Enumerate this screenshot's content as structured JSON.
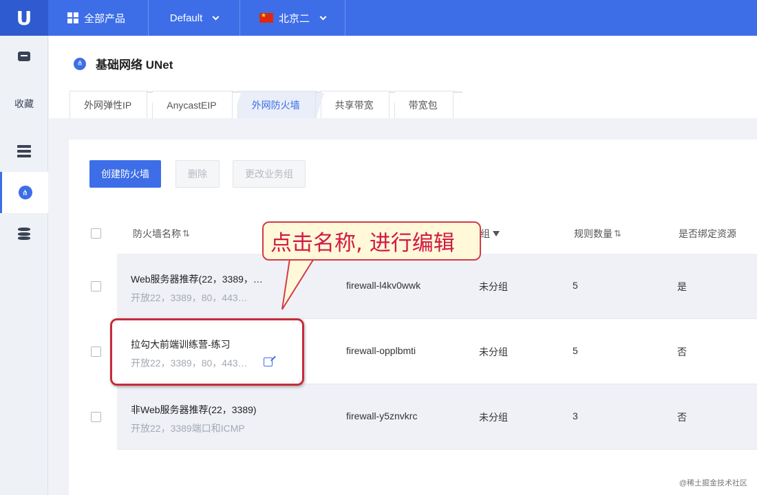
{
  "topbar": {
    "logo": "U",
    "all_products": "全部产品",
    "project": "Default",
    "region": "北京二"
  },
  "sidebar": {
    "favorites_label": "收藏"
  },
  "header": {
    "title": "基础网络 UNet",
    "tabs": [
      {
        "label": "外网弹性IP"
      },
      {
        "label": "AnycastEIP"
      },
      {
        "label": "外网防火墙"
      },
      {
        "label": "共享带宽"
      },
      {
        "label": "带宽包"
      }
    ],
    "active_tab": "外网防火墙"
  },
  "toolbar": {
    "create_label": "创建防火墙",
    "delete_label": "删除",
    "change_group_label": "更改业务组"
  },
  "table": {
    "columns": {
      "name": "防火墙名称",
      "group": "业务组",
      "rules": "规则数量",
      "bound": "是否绑定资源"
    },
    "rows": [
      {
        "name": "Web服务器推荐(22，3389，…",
        "desc": "开放22，3389，80，443…",
        "id": "firewall-l4kv0wwk",
        "group": "未分组",
        "rules": "5",
        "bound": "是"
      },
      {
        "name": "拉勾大前端训练营-练习",
        "desc": "开放22，3389，80，443…",
        "id": "firewall-opplbmti",
        "group": "未分组",
        "rules": "5",
        "bound": "否"
      },
      {
        "name": "非Web服务器推荐(22，3389)",
        "desc": "开放22，3389端口和ICMP",
        "id": "firewall-y5znvkrc",
        "group": "未分组",
        "rules": "3",
        "bound": "否"
      }
    ]
  },
  "annotation": {
    "text": "点击名称, 进行编辑"
  },
  "watermark": "@稀土掘金技术社区",
  "colors": {
    "primary": "#3d6ee8",
    "annotation_border": "#d33848",
    "annotation_text": "#d11a44"
  }
}
